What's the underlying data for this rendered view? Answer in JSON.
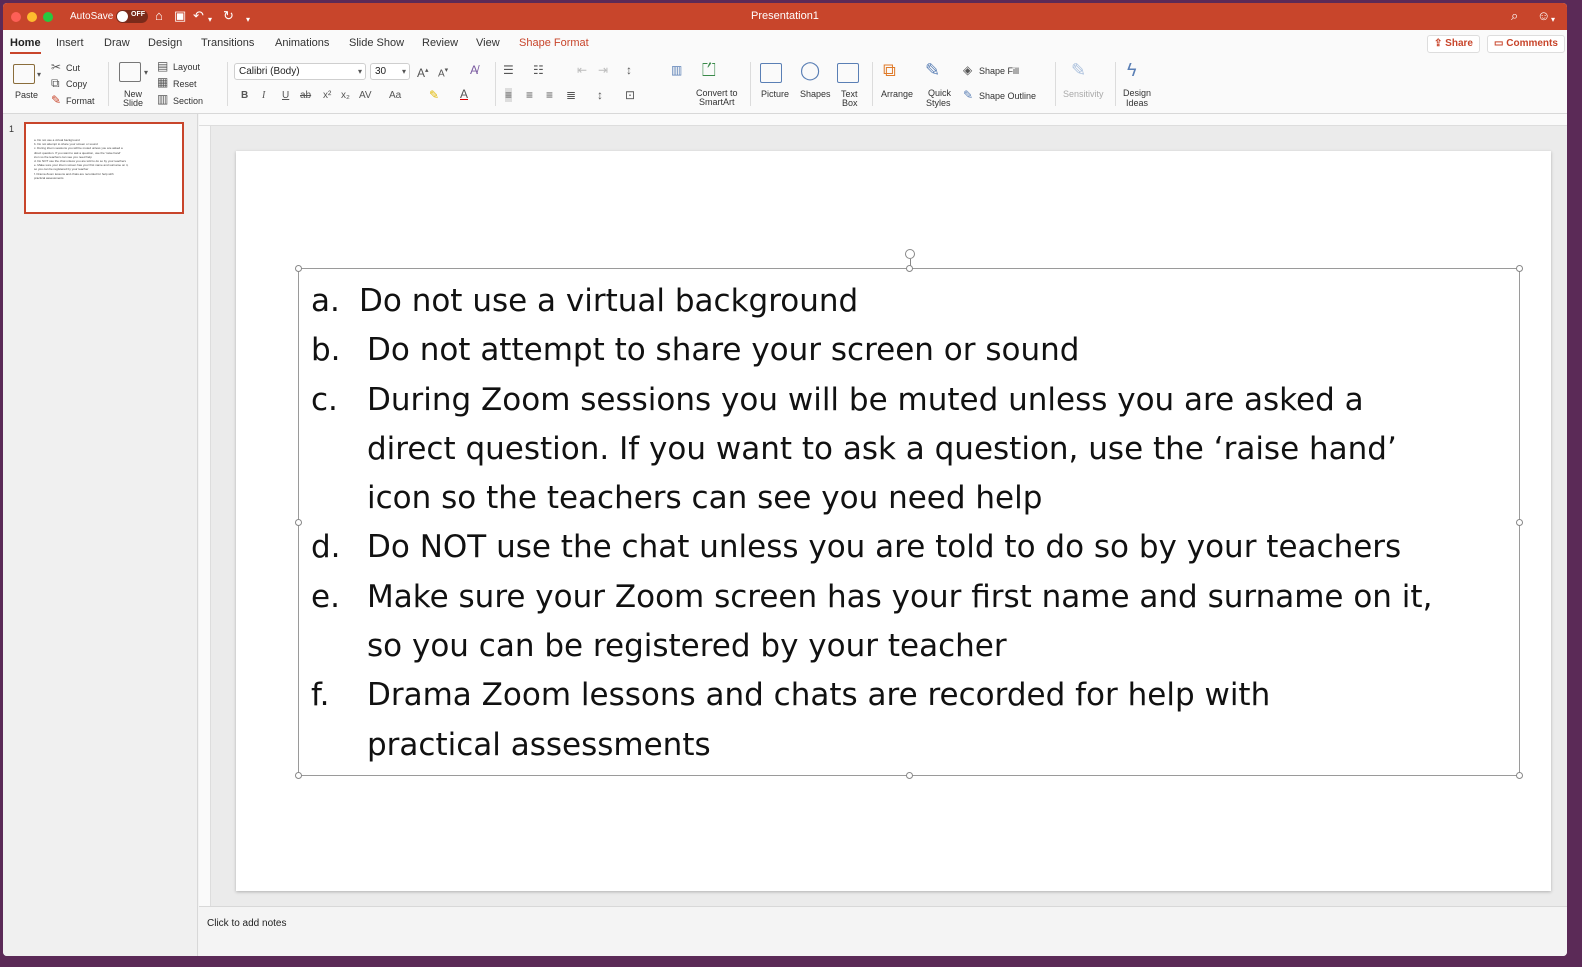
{
  "window": {
    "title": "Presentation1",
    "autosave_label": "AutoSave",
    "autosave_state": "OFF"
  },
  "tabs": [
    {
      "label": "Home"
    },
    {
      "label": "Insert"
    },
    {
      "label": "Draw"
    },
    {
      "label": "Design"
    },
    {
      "label": "Transitions"
    },
    {
      "label": "Animations"
    },
    {
      "label": "Slide Show"
    },
    {
      "label": "Review"
    },
    {
      "label": "View"
    },
    {
      "label": "Shape Format"
    }
  ],
  "share": {
    "share_label": "Share",
    "comments_label": "Comments"
  },
  "toolbar": {
    "paste": "Paste",
    "cut": "Cut",
    "copy": "Copy",
    "format": "Format",
    "new_slide_1": "New",
    "new_slide_2": "Slide",
    "layout": "Layout",
    "reset": "Reset",
    "section": "Section",
    "font_name": "Calibri (Body)",
    "font_size": "30",
    "convert_1": "Convert to",
    "convert_2": "SmartArt",
    "picture": "Picture",
    "shapes": "Shapes",
    "textbox_1": "Text",
    "textbox_2": "Box",
    "arrange": "Arrange",
    "quick_1": "Quick",
    "quick_2": "Styles",
    "shape_fill": "Shape Fill",
    "shape_outline": "Shape Outline",
    "sensitivity": "Sensitivity",
    "design_1": "Design",
    "design_2": "Ideas",
    "bold": "B",
    "italic": "I",
    "underline": "U",
    "strike": "ab",
    "superscript": "x²",
    "subscript": "x₂",
    "spacing": "AV",
    "case": "Aa"
  },
  "slide_panel": {
    "number": "1",
    "thumb_lines": [
      "a. Do not use a virtual background",
      "b. Do not attempt to share your screen or sound",
      "c. During Zoom sessions you will be muted unless you are asked a",
      "   direct question. If you want to ask a question, use the 'raise hand'",
      "   icon so the teachers can see you need help",
      "d. Do NOT use the chat unless you are told to do so by your teachers",
      "e. Make sure your Zoom screen has your first name and surname on it,",
      "   so you can be registered by your teacher",
      "f. Drama Zoom lessons and chats are recorded for help with",
      "   practical assessments"
    ]
  },
  "slide": {
    "items": [
      {
        "marker": "a.",
        "lines": [
          "Do not use a virtual background"
        ]
      },
      {
        "marker": "b.",
        "lines": [
          "Do not attempt to share your screen or sound"
        ]
      },
      {
        "marker": "c.",
        "lines": [
          "During Zoom sessions you will be muted unless you are asked a",
          "direct question. If you want to ask a question, use the ‘raise hand’",
          "icon so the teachers can see you need help"
        ]
      },
      {
        "marker": "d.",
        "lines": [
          "Do NOT use the chat unless you are told to do so by your teachers"
        ]
      },
      {
        "marker": "e.",
        "lines": [
          "Make sure your Zoom screen has your first name and surname on it,",
          "so you can be registered by your teacher"
        ]
      },
      {
        "marker": "f.",
        "lines": [
          "Drama Zoom lessons and chats are recorded for help with",
          "practical assessments"
        ]
      }
    ]
  },
  "notes": {
    "placeholder": "Click to add notes"
  },
  "colors": {
    "accent": "#c8452b",
    "titlebar": "#c8452b"
  }
}
